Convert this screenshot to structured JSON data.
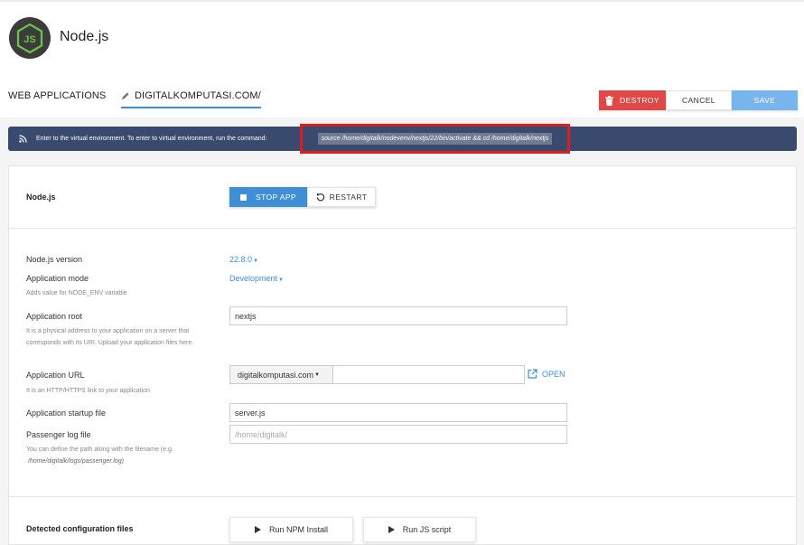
{
  "header": {
    "title": "Node.js",
    "logo_text": "JS"
  },
  "tabs": {
    "web_applications": "WEB APPLICATIONS",
    "current_app": "DIGITALKOMPUTASI.COM/"
  },
  "actions": {
    "destroy": "DESTROY",
    "cancel": "CANCEL",
    "save": "SAVE"
  },
  "info": {
    "text": "Enter to the virtual environment. To enter to virtual environment, run the command:",
    "command": "source /home/digitalk/nodevenv/nextjs/22/bin/activate && cd /home/digitalk/nextjs"
  },
  "nodejs_section": {
    "title": "Node.js",
    "stop_app": "STOP APP",
    "restart": "RESTART"
  },
  "form": {
    "version_label": "Node.js version",
    "version_value": "22.8.0",
    "mode_label": "Application mode",
    "mode_value": "Development",
    "mode_hint": "Adds value for NODE_ENV variable",
    "root_label": "Application root",
    "root_value": "nextjs",
    "root_hint": "It is a physical address to your application on a server that corresponds with its URI. Upload your application files here.",
    "url_label": "Application URL",
    "url_domain": "digitalkomputasi.com",
    "url_hint": "It is an HTTP/HTTPS link to your application",
    "open_label": "OPEN",
    "startup_label": "Application startup file",
    "startup_value": "server.js",
    "log_label": "Passenger log file",
    "log_placeholder": "/home/digitalk/",
    "log_hint": "You can define the path along with the filename (e.g.",
    "log_hint_example": "/home/digitalk/logs/passenger.log)"
  },
  "config_section": {
    "title": "Detected configuration files",
    "npm_install": "Run NPM Install",
    "js_script": "Run JS script"
  },
  "colors": {
    "accent": "#3f8fd6",
    "danger": "#e04848",
    "info_bg": "#3a4a6e",
    "highlight": "#dd1e1e"
  }
}
